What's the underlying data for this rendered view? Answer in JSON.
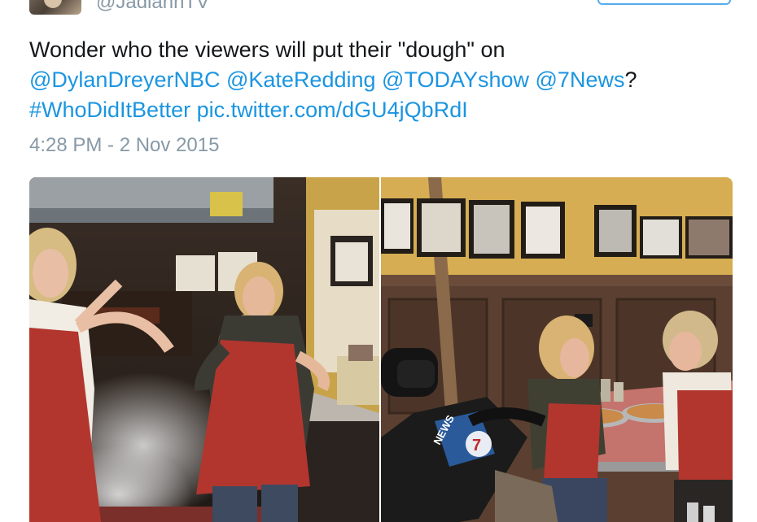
{
  "header": {
    "handle": "@JadiannTV"
  },
  "tweet": {
    "text_lead": "Wonder who the viewers will put their \"dough\" on",
    "mentions": [
      "@DylanDreyerNBC",
      "@KateRedding",
      "@TODAYshow",
      "@7News"
    ],
    "question_mark": "?",
    "hashtag": "#WhoDidItBetter",
    "link": "pic.twitter.com/dGU4jQbRdI",
    "timestamp": "4:28 PM - 2 Nov 2015"
  },
  "media": {
    "photos": [
      {
        "name": "pizza-kitchen-photo",
        "camera_text": ""
      },
      {
        "name": "pizza-eating-photo",
        "camera_text": "NEWS 7"
      }
    ]
  },
  "colors": {
    "link": "#1b95e0",
    "muted": "#8899a6",
    "text": "#14171a"
  }
}
